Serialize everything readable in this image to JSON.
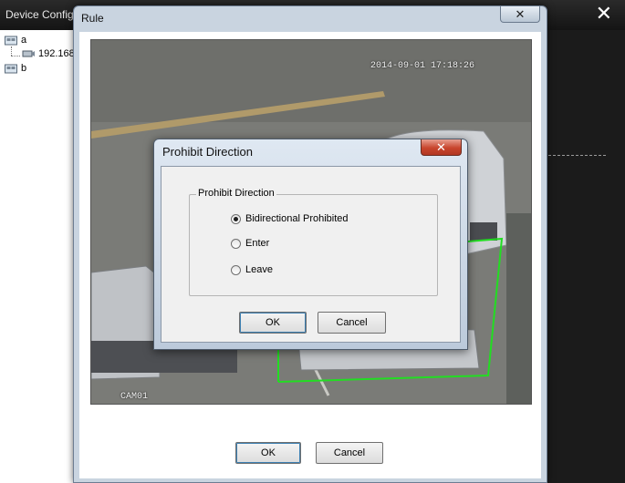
{
  "app": {
    "title": "Device Config",
    "close_glyph": "✕"
  },
  "tree": {
    "nodes": [
      {
        "label": "a",
        "icon": "group-folder-icon"
      },
      {
        "label": "192.168",
        "icon": "camera-device-icon"
      },
      {
        "label": "b",
        "icon": "group-folder-icon"
      }
    ]
  },
  "rule_dialog": {
    "title": "Rule",
    "close_glyph": "✕",
    "video": {
      "timestamp": "2014-09-01 17:18:26",
      "channel": "CAM01",
      "zone_color": "#22dd22"
    },
    "ok_label": "OK",
    "cancel_label": "Cancel"
  },
  "prohibit_dialog": {
    "title": "Prohibit Direction",
    "close_glyph": "✕",
    "group_label": "Prohibit Direction",
    "options": [
      {
        "label": "Bidirectional Prohibited",
        "checked": true
      },
      {
        "label": "Enter",
        "checked": false
      },
      {
        "label": "Leave",
        "checked": false
      }
    ],
    "ok_label": "OK",
    "cancel_label": "Cancel"
  },
  "colors": {
    "accent": "#3c7fb1",
    "close_red": "#c8452d"
  }
}
